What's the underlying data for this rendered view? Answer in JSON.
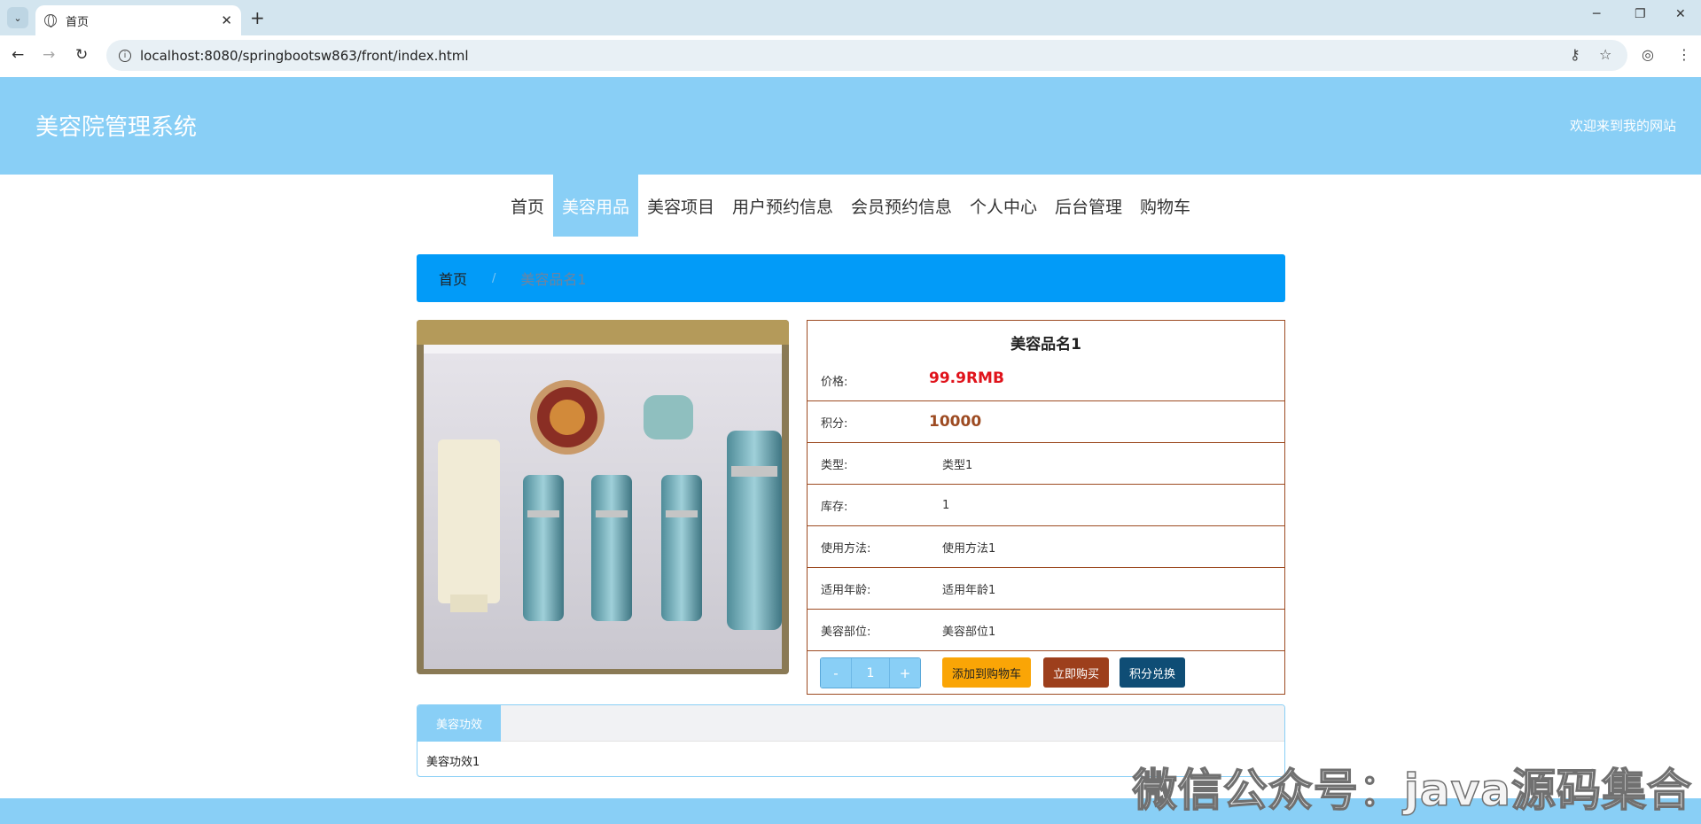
{
  "browser": {
    "tab_title": "首页",
    "url": "localhost:8080/springbootsw863/front/index.html"
  },
  "header": {
    "site_title": "美容院管理系统",
    "welcome": "欢迎来到我的网站"
  },
  "nav": {
    "items": [
      "首页",
      "美容用品",
      "美容项目",
      "用户预约信息",
      "会员预约信息",
      "个人中心",
      "后台管理",
      "购物车"
    ],
    "active": "美容用品"
  },
  "breadcrumb": {
    "home": "首页",
    "separator": "/",
    "current": "美容品名1"
  },
  "product": {
    "name": "美容品名1",
    "price_label": "价格:",
    "price": "99.9RMB",
    "points_label": "积分:",
    "points": "10000",
    "type_label": "类型:",
    "type": "类型1",
    "stock_label": "库存:",
    "stock": "1",
    "usage_label": "使用方法:",
    "usage": "使用方法1",
    "age_label": "适用年龄:",
    "age": "适用年龄1",
    "area_label": "美容部位:",
    "area": "美容部位1"
  },
  "actions": {
    "minus": "-",
    "quantity": "1",
    "plus": "+",
    "add_to_cart": "添加到购物车",
    "buy_now": "立即购买",
    "points_exchange": "积分兑换"
  },
  "effect": {
    "tab_label": "美容功效",
    "content": "美容功效1"
  },
  "watermark": "微信公众号：java源码集合",
  "colors": {
    "header_bg": "#89cff6",
    "breadcrumb_bg": "#029bf8",
    "price": "#e0131b",
    "border": "#9d4b22",
    "cart_button": "#faa506",
    "buy_button": "#9d3f1c",
    "points_button": "#0f4d75"
  }
}
